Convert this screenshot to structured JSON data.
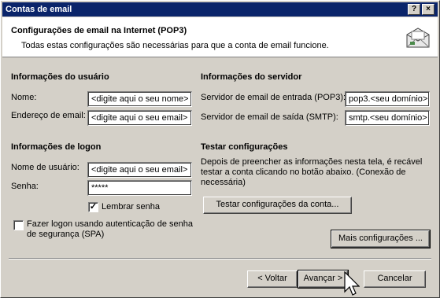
{
  "window": {
    "title": "Contas de email",
    "help_button": "?",
    "close_button": "×"
  },
  "header": {
    "title": "Configurações de email na Internet (POP3)",
    "subtitle": "Todas estas configurações são necessárias para que a conta de email funcione."
  },
  "user_info": {
    "section": "Informações do usuário",
    "name_label": "Nome:",
    "name_value": "<digite aqui o seu nome>",
    "email_label": "Endereço de email:",
    "email_value": "<digite aqui o seu email>"
  },
  "server_info": {
    "section": "Informações do servidor",
    "incoming_label": "Servidor de email de entrada (POP3):",
    "incoming_value": "pop3.<seu domínio>",
    "outgoing_label": "Servidor de email de saída (SMTP):",
    "outgoing_value": "smtp.<seu domínio>"
  },
  "logon_info": {
    "section": "Informações de logon",
    "username_label": "Nome de usuário:",
    "username_value": "<digite aqui o seu email>",
    "password_label": "Senha:",
    "password_value": "*****",
    "remember_label": "Lembrar senha",
    "remember_checked": true,
    "spa_label_line1": "Fazer logon usando autenticação de senha",
    "spa_label_line2": "de segurança (SPA)",
    "spa_checked": false
  },
  "test_settings": {
    "section": "Testar configurações",
    "description_line1": "Depois de preencher as informações nesta tela, é recável",
    "description_line2": "testar a conta clicando no botão abaixo. (Conexão de",
    "description_line3": "necessária)",
    "test_button": "Testar configurações da conta...",
    "more_button": "Mais configurações ..."
  },
  "footer": {
    "back_button": "< Voltar",
    "next_button": "Avançar >",
    "cancel_button": "Cancelar"
  }
}
